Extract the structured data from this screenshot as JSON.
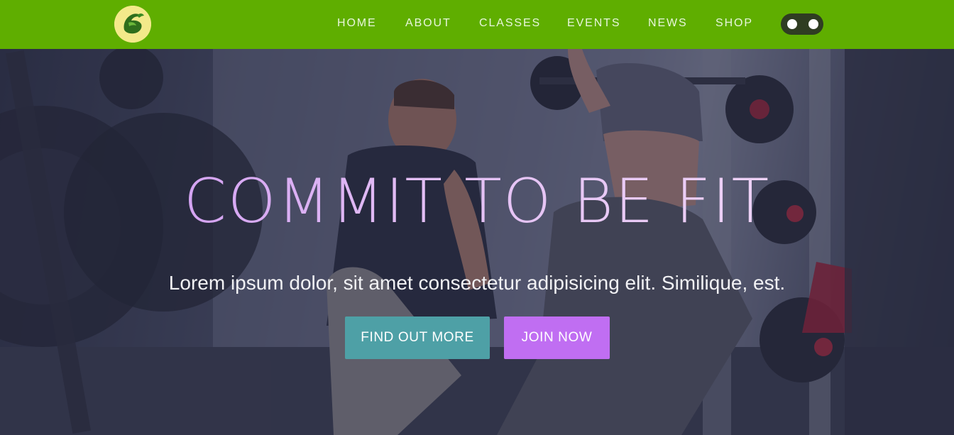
{
  "nav": {
    "logo_alt": "logo",
    "links": [
      "HOME",
      "ABOUT",
      "CLASSES",
      "EVENTS",
      "NEWS",
      "SHOP"
    ],
    "toggle_icon": "toggle-switch-icon"
  },
  "hero": {
    "title": "COMMIT TO BE FIT",
    "subtitle": "Lorem ipsum dolor, sit amet consectetur adipisicing elit. Similique, est.",
    "buttons": {
      "find_out_more": "FIND OUT MORE",
      "join_now": "JOIN NOW"
    }
  },
  "colors": {
    "navbar": "#5fae00",
    "find_button": "#4ea0a6",
    "join_button": "#c06ef2",
    "title_gradient_start": "#c98ef0",
    "title_gradient_end": "#f3dcf6"
  }
}
